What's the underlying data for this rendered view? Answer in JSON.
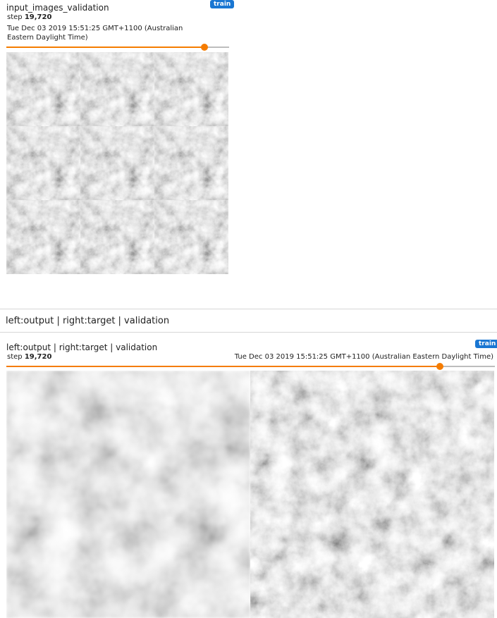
{
  "card1": {
    "title": "input_images_validation",
    "run": "train",
    "step_label": "step",
    "step_value": "19,720",
    "wall_time": "Tue Dec 03 2019 15:51:25 GMT+1100 (Australian Eastern Daylight Time)",
    "slider_fraction": 0.89
  },
  "group": {
    "header": "left:output | right:target | validation"
  },
  "card2": {
    "title": "left:output | right:target | validation",
    "run": "train",
    "step_label": "step",
    "step_value": "19,720",
    "wall_time": "Tue Dec 03 2019 15:51:25 GMT+1100 (Australian Eastern Daylight Time)",
    "slider_fraction": 0.888
  },
  "colors": {
    "accent": "#f57c00",
    "run_chip": "#1976d2",
    "divider": "#d6d6d6"
  }
}
